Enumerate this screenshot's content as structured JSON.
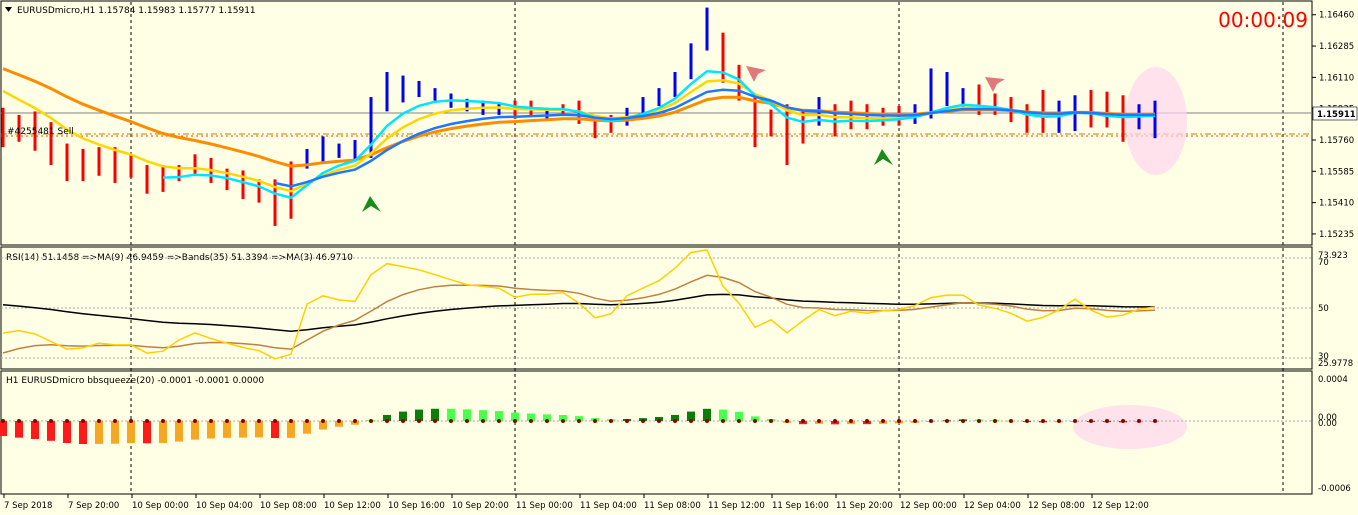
{
  "chart_header": {
    "title": "EURUSDmicro,H1  1.15784 1.15983 1.15777 1.15911",
    "clock": "00:00:09",
    "hidden_label": "#4255481 Sell"
  },
  "price_axis": {
    "ticks": [
      "1.16460",
      "1.16285",
      "1.16110",
      "1.15935",
      "1.15760",
      "1.15585",
      "1.15410",
      "1.15235"
    ],
    "current_price": "1.15911",
    "ylim": [
      1.1519,
      1.1652
    ]
  },
  "rsi_panel": {
    "label": "RSI(14) 51.1458  =>MA(9) 46.9459  =>Bands(35) 51.3394  =>MA(3) 46.9710",
    "ticks": [
      "73.923",
      "70",
      "50",
      "30",
      "25.9778"
    ]
  },
  "squeeze_panel": {
    "label": "H1 EURUSDmicro bbsqueeze(20) -0.0001 -0.0001 0.0000",
    "ticks": [
      "0.0004",
      "0.00",
      "0.00",
      "-0.0006"
    ]
  },
  "time_axis": {
    "labels": [
      "7 Sep 2018",
      "7 Sep 20:00",
      "10 Sep 00:00",
      "10 Sep 04:00",
      "10 Sep 08:00",
      "10 Sep 12:00",
      "10 Sep 16:00",
      "10 Sep 20:00",
      "11 Sep 00:00",
      "11 Sep 04:00",
      "11 Sep 08:00",
      "11 Sep 12:00",
      "11 Sep 16:00",
      "11 Sep 20:00",
      "12 Sep 00:00",
      "12 Sep 04:00",
      "12 Sep 08:00",
      "12 Sep 12:00"
    ]
  },
  "colors": {
    "bull": "#0000ff",
    "bear": "#ff0000",
    "ma_fast": "#ffd700",
    "ma_slow": "#ff8c00",
    "ma_cyan": "#00e5ff",
    "ma_blue": "#1e78ff"
  },
  "chart_data": [
    {
      "type": "candlestick",
      "title": "EURUSDmicro,H1",
      "ylim": [
        1.1519,
        1.1652
      ],
      "bars": [
        {
          "t": "7 Sep 13:00",
          "o": 1.1589,
          "h": 1.1594,
          "l": 1.1572,
          "c": 1.1577
        },
        {
          "t": "7 Sep 14:00",
          "o": 1.1582,
          "h": 1.159,
          "l": 1.1575,
          "c": 1.1579
        },
        {
          "t": "7 Sep 15:00",
          "o": 1.1584,
          "h": 1.1592,
          "l": 1.157,
          "c": 1.1575
        },
        {
          "t": "7 Sep 16:00",
          "o": 1.1581,
          "h": 1.1586,
          "l": 1.1562,
          "c": 1.1566
        },
        {
          "t": "7 Sep 17:00",
          "o": 1.157,
          "h": 1.1574,
          "l": 1.1553,
          "c": 1.1556
        },
        {
          "t": "7 Sep 18:00",
          "o": 1.1566,
          "h": 1.1571,
          "l": 1.1553,
          "c": 1.1557
        },
        {
          "t": "7 Sep 19:00",
          "o": 1.1568,
          "h": 1.1572,
          "l": 1.1556,
          "c": 1.156
        },
        {
          "t": "7 Sep 20:00",
          "o": 1.1568,
          "h": 1.1572,
          "l": 1.1552,
          "c": 1.1558
        },
        {
          "t": "7 Sep 21:00",
          "o": 1.1564,
          "h": 1.1568,
          "l": 1.1555,
          "c": 1.1558
        },
        {
          "t": "10 Sep 00:00",
          "o": 1.156,
          "h": 1.1562,
          "l": 1.1546,
          "c": 1.1549
        },
        {
          "t": "10 Sep 01:00",
          "o": 1.1558,
          "h": 1.1562,
          "l": 1.1547,
          "c": 1.155
        },
        {
          "t": "10 Sep 02:00",
          "o": 1.156,
          "h": 1.1562,
          "l": 1.1553,
          "c": 1.1556
        },
        {
          "t": "10 Sep 03:00",
          "o": 1.1566,
          "h": 1.1568,
          "l": 1.1557,
          "c": 1.156
        },
        {
          "t": "10 Sep 04:00",
          "o": 1.1563,
          "h": 1.1566,
          "l": 1.1552,
          "c": 1.1555
        },
        {
          "t": "10 Sep 05:00",
          "o": 1.1558,
          "h": 1.156,
          "l": 1.1548,
          "c": 1.1551
        },
        {
          "t": "10 Sep 06:00",
          "o": 1.1557,
          "h": 1.1559,
          "l": 1.1543,
          "c": 1.1547
        },
        {
          "t": "10 Sep 07:00",
          "o": 1.1551,
          "h": 1.1554,
          "l": 1.1541,
          "c": 1.1544
        },
        {
          "t": "10 Sep 08:00",
          "o": 1.155,
          "h": 1.1554,
          "l": 1.1528,
          "c": 1.1536
        },
        {
          "t": "10 Sep 09:00",
          "o": 1.1562,
          "h": 1.1564,
          "l": 1.1532,
          "c": 1.1538
        },
        {
          "t": "10 Sep 10:00",
          "o": 1.1562,
          "h": 1.1571,
          "l": 1.156,
          "c": 1.1568
        },
        {
          "t": "10 Sep 11:00",
          "o": 1.1566,
          "h": 1.1578,
          "l": 1.1564,
          "c": 1.1575
        },
        {
          "t": "10 Sep 12:00",
          "o": 1.157,
          "h": 1.1574,
          "l": 1.1566,
          "c": 1.1572
        },
        {
          "t": "10 Sep 13:00",
          "o": 1.1566,
          "h": 1.1576,
          "l": 1.1564,
          "c": 1.1571
        },
        {
          "t": "10 Sep 14:00",
          "o": 1.1568,
          "h": 1.16,
          "l": 1.1566,
          "c": 1.1596
        },
        {
          "t": "10 Sep 15:00",
          "o": 1.1596,
          "h": 1.1614,
          "l": 1.1592,
          "c": 1.161
        },
        {
          "t": "10 Sep 16:00",
          "o": 1.16,
          "h": 1.1612,
          "l": 1.1597,
          "c": 1.1608
        },
        {
          "t": "10 Sep 17:00",
          "o": 1.1603,
          "h": 1.1609,
          "l": 1.16,
          "c": 1.1606
        },
        {
          "t": "10 Sep 18:00",
          "o": 1.16,
          "h": 1.1605,
          "l": 1.1598,
          "c": 1.1603
        },
        {
          "t": "10 Sep 19:00",
          "o": 1.1596,
          "h": 1.1602,
          "l": 1.1594,
          "c": 1.16
        },
        {
          "t": "10 Sep 20:00",
          "o": 1.1594,
          "h": 1.1599,
          "l": 1.1592,
          "c": 1.1597
        },
        {
          "t": "10 Sep 21:00",
          "o": 1.1593,
          "h": 1.1598,
          "l": 1.159,
          "c": 1.1596
        },
        {
          "t": "10 Sep 22:00",
          "o": 1.1592,
          "h": 1.1597,
          "l": 1.159,
          "c": 1.1595
        },
        {
          "t": "10 Sep 23:00",
          "o": 1.1596,
          "h": 1.1598,
          "l": 1.1588,
          "c": 1.159
        },
        {
          "t": "11 Sep 00:00",
          "o": 1.1593,
          "h": 1.1598,
          "l": 1.1589,
          "c": 1.1592
        },
        {
          "t": "11 Sep 01:00",
          "o": 1.159,
          "h": 1.1594,
          "l": 1.1588,
          "c": 1.1592
        },
        {
          "t": "11 Sep 02:00",
          "o": 1.1594,
          "h": 1.1596,
          "l": 1.159,
          "c": 1.1593
        },
        {
          "t": "11 Sep 03:00",
          "o": 1.1596,
          "h": 1.1598,
          "l": 1.1585,
          "c": 1.1588
        },
        {
          "t": "11 Sep 04:00",
          "o": 1.1589,
          "h": 1.159,
          "l": 1.1577,
          "c": 1.158
        },
        {
          "t": "11 Sep 05:00",
          "o": 1.1588,
          "h": 1.159,
          "l": 1.158,
          "c": 1.1582
        },
        {
          "t": "11 Sep 06:00",
          "o": 1.1586,
          "h": 1.1594,
          "l": 1.1584,
          "c": 1.1592
        },
        {
          "t": "11 Sep 07:00",
          "o": 1.1592,
          "h": 1.16,
          "l": 1.159,
          "c": 1.1597
        },
        {
          "t": "11 Sep 08:00",
          "o": 1.1597,
          "h": 1.1605,
          "l": 1.1595,
          "c": 1.1602
        },
        {
          "t": "11 Sep 09:00",
          "o": 1.1602,
          "h": 1.1614,
          "l": 1.16,
          "c": 1.1612
        },
        {
          "t": "11 Sep 10:00",
          "o": 1.1612,
          "h": 1.163,
          "l": 1.161,
          "c": 1.1628
        },
        {
          "t": "11 Sep 11:00",
          "o": 1.1628,
          "h": 1.165,
          "l": 1.1626,
          "c": 1.1632
        },
        {
          "t": "11 Sep 12:00",
          "o": 1.1624,
          "h": 1.1636,
          "l": 1.1608,
          "c": 1.1612
        },
        {
          "t": "11 Sep 13:00",
          "o": 1.1612,
          "h": 1.1618,
          "l": 1.1598,
          "c": 1.16
        },
        {
          "t": "11 Sep 14:00",
          "o": 1.16,
          "h": 1.1602,
          "l": 1.1572,
          "c": 1.1578
        },
        {
          "t": "11 Sep 15:00",
          "o": 1.159,
          "h": 1.1593,
          "l": 1.1578,
          "c": 1.1584
        },
        {
          "t": "11 Sep 16:00",
          "o": 1.1592,
          "h": 1.1596,
          "l": 1.1562,
          "c": 1.157
        },
        {
          "t": "11 Sep 17:00",
          "o": 1.1588,
          "h": 1.1592,
          "l": 1.1574,
          "c": 1.158
        },
        {
          "t": "11 Sep 18:00",
          "o": 1.1588,
          "h": 1.16,
          "l": 1.1584,
          "c": 1.159
        },
        {
          "t": "11 Sep 19:00",
          "o": 1.1594,
          "h": 1.1596,
          "l": 1.1578,
          "c": 1.1584
        },
        {
          "t": "11 Sep 20:00",
          "o": 1.159,
          "h": 1.1598,
          "l": 1.1582,
          "c": 1.1588
        },
        {
          "t": "11 Sep 21:00",
          "o": 1.1592,
          "h": 1.1596,
          "l": 1.1582,
          "c": 1.1586
        },
        {
          "t": "11 Sep 22:00",
          "o": 1.159,
          "h": 1.1594,
          "l": 1.1584,
          "c": 1.1588
        },
        {
          "t": "11 Sep 23:00",
          "o": 1.159,
          "h": 1.1595,
          "l": 1.1584,
          "c": 1.1589
        },
        {
          "t": "12 Sep 00:00",
          "o": 1.1588,
          "h": 1.1596,
          "l": 1.1585,
          "c": 1.1592
        },
        {
          "t": "12 Sep 01:00",
          "o": 1.159,
          "h": 1.1616,
          "l": 1.1588,
          "c": 1.1598
        },
        {
          "t": "12 Sep 02:00",
          "o": 1.1597,
          "h": 1.1614,
          "l": 1.1595,
          "c": 1.16
        },
        {
          "t": "12 Sep 03:00",
          "o": 1.1598,
          "h": 1.1605,
          "l": 1.1592,
          "c": 1.16
        },
        {
          "t": "12 Sep 04:00",
          "o": 1.1601,
          "h": 1.1607,
          "l": 1.159,
          "c": 1.1594
        },
        {
          "t": "12 Sep 05:00",
          "o": 1.1597,
          "h": 1.1602,
          "l": 1.159,
          "c": 1.1592
        },
        {
          "t": "12 Sep 06:00",
          "o": 1.1594,
          "h": 1.16,
          "l": 1.1586,
          "c": 1.1589
        },
        {
          "t": "12 Sep 07:00",
          "o": 1.1594,
          "h": 1.1596,
          "l": 1.158,
          "c": 1.1584
        },
        {
          "t": "12 Sep 08:00",
          "o": 1.1596,
          "h": 1.1604,
          "l": 1.158,
          "c": 1.1586
        },
        {
          "t": "12 Sep 09:00",
          "o": 1.1587,
          "h": 1.1598,
          "l": 1.158,
          "c": 1.159
        },
        {
          "t": "12 Sep 10:00",
          "o": 1.1589,
          "h": 1.1601,
          "l": 1.1581,
          "c": 1.1596
        },
        {
          "t": "12 Sep 11:00",
          "o": 1.1596,
          "h": 1.1604,
          "l": 1.1583,
          "c": 1.159
        },
        {
          "t": "12 Sep 12:00",
          "o": 1.1594,
          "h": 1.1603,
          "l": 1.1583,
          "c": 1.1586
        },
        {
          "t": "12 Sep 13:00",
          "o": 1.1591,
          "h": 1.1601,
          "l": 1.1575,
          "c": 1.1587
        },
        {
          "t": "12 Sep 14:00",
          "o": 1.1589,
          "h": 1.1596,
          "l": 1.1582,
          "c": 1.159
        },
        {
          "t": "12 Sep 15:00",
          "o": 1.1578,
          "h": 1.1598,
          "l": 1.1577,
          "c": 1.1591
        }
      ]
    }
  ]
}
